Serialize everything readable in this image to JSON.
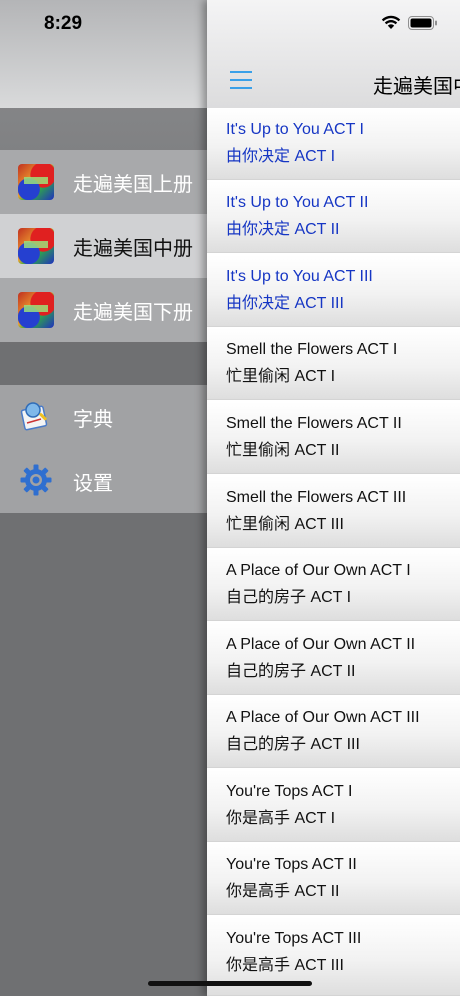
{
  "status": {
    "time": "8:29"
  },
  "drawer": {
    "books": [
      {
        "label": "走遍美国上册"
      },
      {
        "label": "走遍美国中册"
      },
      {
        "label": "走遍美国下册"
      }
    ],
    "tools": [
      {
        "label": "字典",
        "icon": "dictionary-icon"
      },
      {
        "label": "设置",
        "icon": "gear-icon"
      }
    ]
  },
  "nav": {
    "title": "走遍美国中"
  },
  "lessons": [
    {
      "en": "It's Up to You  ACT I",
      "cn": "由你决定 ACT I"
    },
    {
      "en": "It's Up to You  ACT II",
      "cn": "由你决定 ACT II"
    },
    {
      "en": "It's Up to You  ACT III",
      "cn": "由你决定 ACT III"
    },
    {
      "en": "Smell the Flowers  ACT I",
      "cn": "忙里偷闲 ACT I"
    },
    {
      "en": "Smell the Flowers  ACT II",
      "cn": "忙里偷闲 ACT II"
    },
    {
      "en": "Smell the Flowers  ACT III",
      "cn": "忙里偷闲 ACT III"
    },
    {
      "en": "A Place of Our Own ACT I",
      "cn": "自己的房子 ACT I"
    },
    {
      "en": "A Place of Our Own ACT II",
      "cn": "自己的房子 ACT II"
    },
    {
      "en": "A Place of Our Own ACT III",
      "cn": "自己的房子 ACT III"
    },
    {
      "en": "You're Tops ACT I",
      "cn": "你是高手 ACT I"
    },
    {
      "en": "You're Tops ACT II",
      "cn": "你是高手 ACT II"
    },
    {
      "en": "You're Tops ACT III",
      "cn": "你是高手 ACT III"
    }
  ],
  "colors": {
    "highlight_blue": "#1636c4",
    "menu_accent": "#3aa0e8"
  }
}
